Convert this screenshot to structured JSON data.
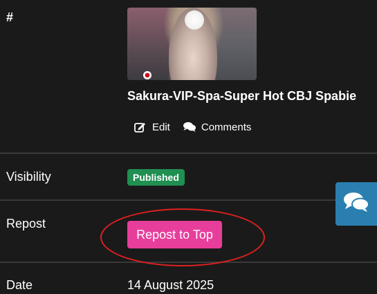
{
  "listing": {
    "label": "#",
    "title": "Sakura-VIP-Spa-Super Hot CBJ Spabie",
    "actions": {
      "edit_label": "Edit",
      "comments_label": "Comments"
    }
  },
  "visibility": {
    "label": "Visibility",
    "status_badge": "Published"
  },
  "repost": {
    "label": "Repost",
    "button_label": "Repost to Top"
  },
  "date": {
    "label": "Date",
    "value": "14 August 2025"
  },
  "icons": {
    "edit": "edit-icon",
    "comments": "comments-icon",
    "chat": "chat-bubbles-icon"
  },
  "colors": {
    "background": "#1a1a1a",
    "badge_published": "#1f8f52",
    "repost_button": "#e83e9b",
    "highlight_ellipse": "#e02020",
    "chat_float": "#2a7fb0"
  }
}
